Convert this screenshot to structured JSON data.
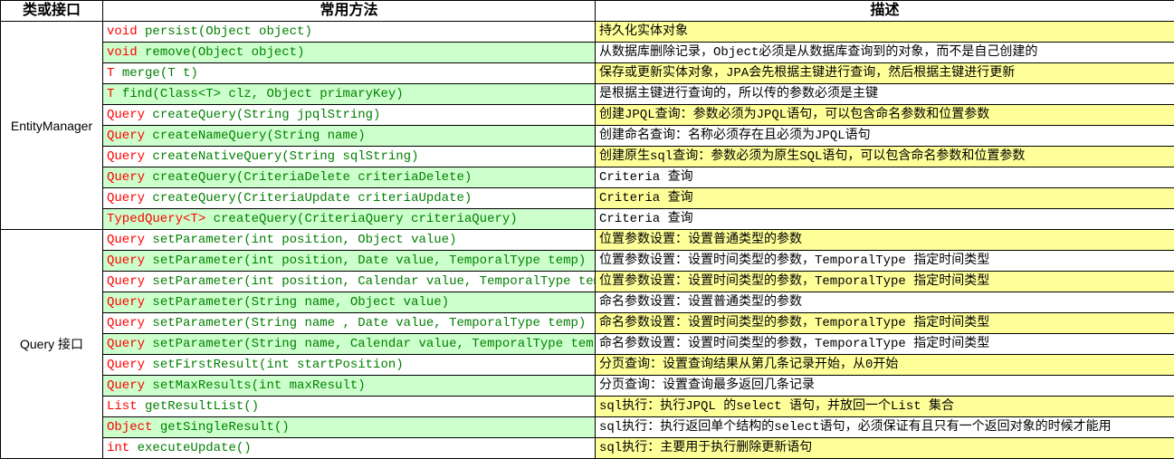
{
  "headers": {
    "group": "类或接口",
    "method": "常用方法",
    "desc": "描述"
  },
  "groups": [
    {
      "name": "EntityManager",
      "rows": [
        {
          "ret": "void",
          "sig": "persist(Object object)",
          "mbg": "bg-white",
          "desc": "持久化实体对象",
          "dbg": "bg-yellow"
        },
        {
          "ret": "void",
          "sig": "remove(Object object)",
          "mbg": "bg-green",
          "desc": "从数据库删除记录，Object必须是从数据库查询到的对象，而不是自己创建的",
          "dbg": "bg-white"
        },
        {
          "ret": "T",
          "sig": "merge(T t)",
          "mbg": "bg-white",
          "desc": "保存或更新实体对象，JPA会先根据主键进行查询，然后根据主键进行更新",
          "dbg": "bg-yellow"
        },
        {
          "ret": "T",
          "sig": "find(Class<T> clz, Object primaryKey)",
          "mbg": "bg-green",
          "desc": "是根据主键进行查询的，所以传的参数必须是主键",
          "dbg": "bg-white"
        },
        {
          "ret": "Query",
          "sig": "createQuery(String jpqlString)",
          "mbg": "bg-white",
          "desc": "创建JPQL查询：参数必须为JPQL语句，可以包含命名参数和位置参数",
          "dbg": "bg-yellow"
        },
        {
          "ret": "Query",
          "sig": "createNameQuery(String name)",
          "mbg": "bg-green",
          "desc": "创建命名查询：名称必须存在且必须为JPQL语句",
          "dbg": "bg-white"
        },
        {
          "ret": "Query",
          "sig": "createNativeQuery(String sqlString)",
          "mbg": "bg-white",
          "desc": "创建原生sql查询：参数必须为原生SQL语句，可以包含命名参数和位置参数",
          "dbg": "bg-yellow"
        },
        {
          "ret": "Query",
          "sig": "createQuery(CriteriaDelete criteriaDelete)",
          "mbg": "bg-green",
          "desc": "Criteria 查询",
          "dbg": "bg-white"
        },
        {
          "ret": "Query",
          "sig": "createQuery(CriteriaUpdate criteriaUpdate)",
          "mbg": "bg-white",
          "desc": "Criteria 查询",
          "dbg": "bg-yellow"
        },
        {
          "ret": "TypedQuery<T>",
          "sig": "createQuery(CriteriaQuery criteriaQuery)",
          "mbg": "bg-green",
          "desc": "Criteria 查询",
          "dbg": "bg-white"
        }
      ]
    },
    {
      "name": "Query 接口",
      "rows": [
        {
          "ret": "Query",
          "sig": "setParameter(int position, Object value)",
          "mbg": "bg-white",
          "desc": "位置参数设置：设置普通类型的参数",
          "dbg": "bg-yellow"
        },
        {
          "ret": "Query",
          "sig": "setParameter(int position, Date value, TemporalType temp)",
          "mbg": "bg-green",
          "desc": "位置参数设置：设置时间类型的参数，TemporalType 指定时间类型",
          "dbg": "bg-white"
        },
        {
          "ret": "Query",
          "sig": "setParameter(int position, Calendar value, TemporalType temp)",
          "mbg": "bg-white",
          "desc": "位置参数设置：设置时间类型的参数，TemporalType 指定时间类型",
          "dbg": "bg-yellow"
        },
        {
          "ret": "Query",
          "sig": "setParameter(String name, Object value)",
          "mbg": "bg-green",
          "desc": "命名参数设置：设置普通类型的参数",
          "dbg": "bg-white"
        },
        {
          "ret": "Query",
          "sig": "setParameter(String name , Date value, TemporalType temp)",
          "mbg": "bg-white",
          "desc": "命名参数设置：设置时间类型的参数，TemporalType 指定时间类型",
          "dbg": "bg-yellow"
        },
        {
          "ret": "Query",
          "sig": "setParameter(String name, Calendar value, TemporalType temp)",
          "mbg": "bg-green",
          "desc": "命名参数设置：设置时间类型的参数，TemporalType 指定时间类型",
          "dbg": "bg-white"
        },
        {
          "ret": "Query",
          "sig": "setFirstResult(int startPosition)",
          "mbg": "bg-white",
          "desc": "分页查询：设置查询结果从第几条记录开始，从0开始",
          "dbg": "bg-yellow"
        },
        {
          "ret": "Query",
          "sig": "setMaxResults(int maxResult)",
          "mbg": "bg-green",
          "desc": "分页查询：设置查询最多返回几条记录",
          "dbg": "bg-white"
        },
        {
          "ret": "List",
          "sig": "getResultList()",
          "mbg": "bg-white",
          "desc": "sql执行：执行JPQL 的select 语句，并放回一个List 集合",
          "dbg": "bg-yellow"
        },
        {
          "ret": "Object",
          "sig": "getSingleResult()",
          "mbg": "bg-green",
          "desc": "sql执行：执行返回单个结构的select语句，必须保证有且只有一个返回对象的时候才能用",
          "dbg": "bg-white"
        },
        {
          "ret": "int",
          "sig": "executeUpdate()",
          "mbg": "bg-white",
          "desc": "sql执行：主要用于执行删除更新语句",
          "dbg": "bg-yellow"
        }
      ]
    }
  ]
}
